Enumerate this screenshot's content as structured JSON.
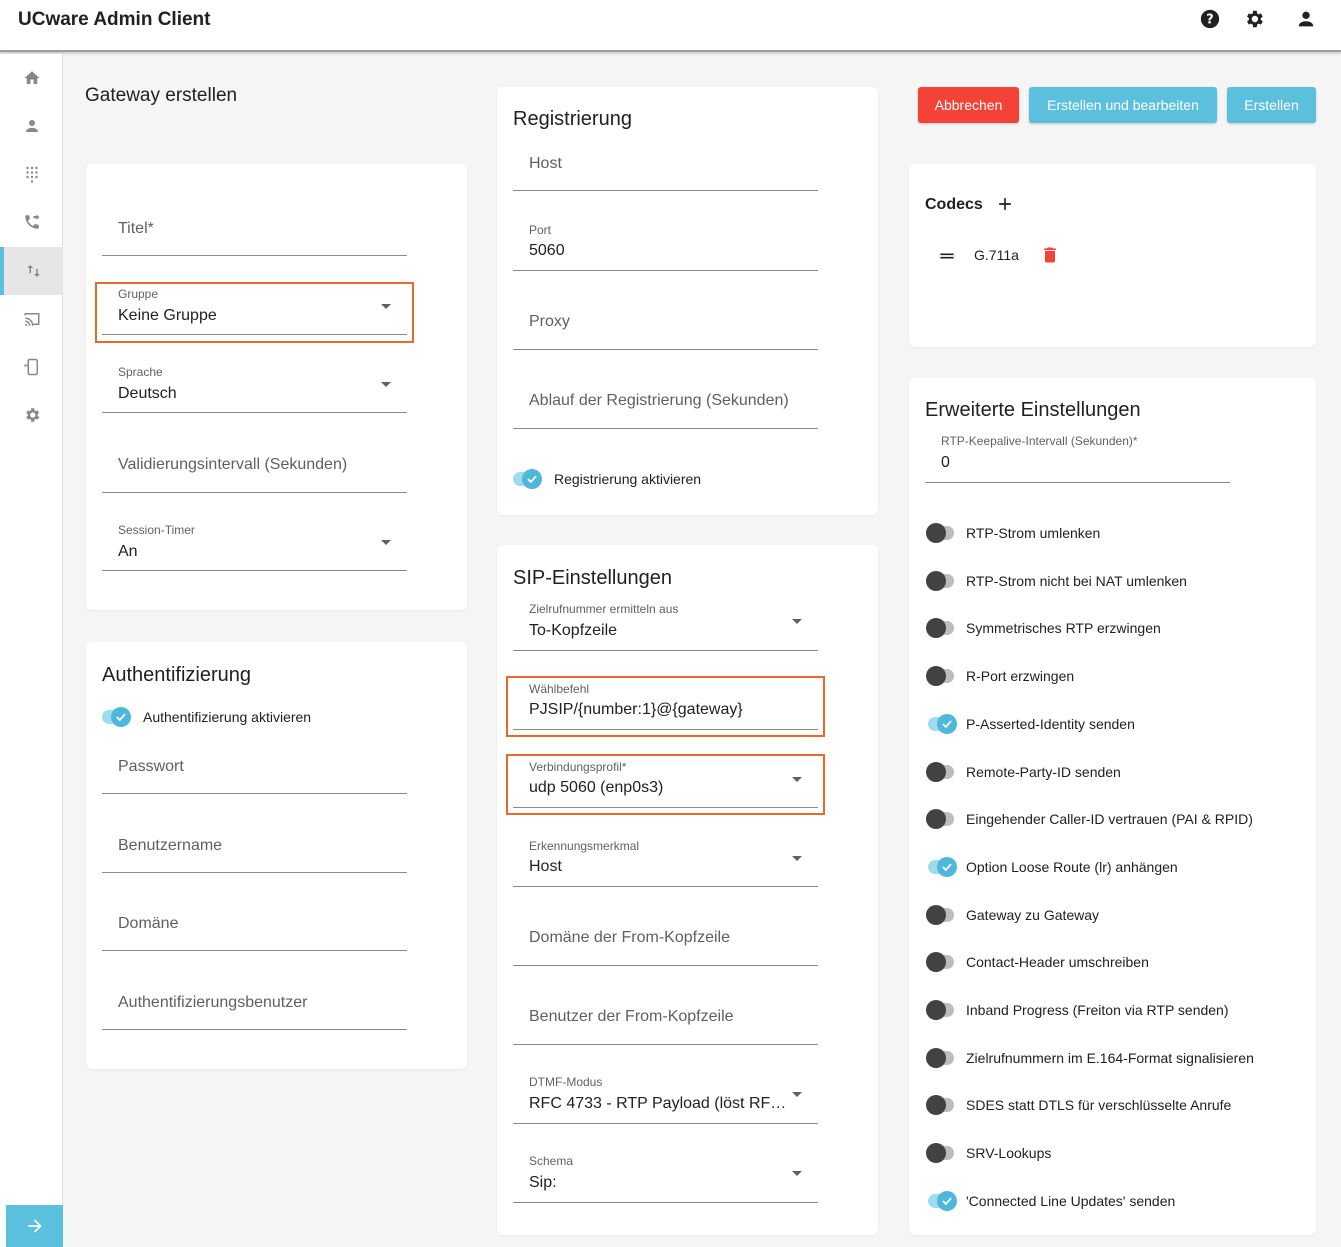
{
  "app": {
    "title": "UCware Admin Client"
  },
  "page": {
    "title": "Gateway erstellen"
  },
  "actions": {
    "cancel": "Abbrechen",
    "create_edit": "Erstellen und bearbeiten",
    "create": "Erstellen"
  },
  "colors": {
    "accent": "#5bc0de",
    "danger": "#f44336",
    "highlight": "#e8692a"
  },
  "general": {
    "title_placeholder": "Titel*",
    "group_label": "Gruppe",
    "group_value": "Keine Gruppe",
    "language_label": "Sprache",
    "language_value": "Deutsch",
    "validation_placeholder": "Validierungsintervall (Sekunden)",
    "session_timer_label": "Session-Timer",
    "session_timer_value": "An"
  },
  "auth": {
    "title": "Authentifizierung",
    "enable_label": "Authentifizierung aktivieren",
    "password": "Passwort",
    "username": "Benutzername",
    "domain": "Domäne",
    "auth_user": "Authentifizierungsbenutzer"
  },
  "registration": {
    "title": "Registrierung",
    "host": "Host",
    "port_label": "Port",
    "port_value": "5060",
    "proxy": "Proxy",
    "expiry": "Ablauf der Registrierung (Sekunden)",
    "enable_label": "Registrierung aktivieren"
  },
  "sip": {
    "title": "SIP-Einstellungen",
    "target_label": "Zielrufnummer ermitteln aus",
    "target_value": "To-Kopfzeile",
    "dial_label": "Wählbefehl",
    "dial_value": "PJSIP/{number:1}@{gateway}",
    "profile_label": "Verbindungsprofil*",
    "profile_value": "udp 5060 (enp0s3)",
    "identify_label": "Erkennungsmerkmal",
    "identify_value": "Host",
    "from_domain": "Domäne der From-Kopfzeile",
    "from_user": "Benutzer der From-Kopfzeile",
    "dtmf_label": "DTMF-Modus",
    "dtmf_value": "RFC 4733 - RTP Payload (löst RF…",
    "schema_label": "Schema",
    "schema_value": "Sip:"
  },
  "codecs": {
    "title": "Codecs",
    "items": [
      "G.711a"
    ]
  },
  "advanced": {
    "title": "Erweiterte Einstellungen",
    "keepalive_label": "RTP-Keepalive-Intervall (Sekunden)*",
    "keepalive_value": "0",
    "toggles": [
      {
        "label": "RTP-Strom umlenken",
        "on": false
      },
      {
        "label": "RTP-Strom nicht bei NAT umlenken",
        "on": false
      },
      {
        "label": "Symmetrisches RTP erzwingen",
        "on": false
      },
      {
        "label": "R-Port erzwingen",
        "on": false
      },
      {
        "label": "P-Asserted-Identity senden",
        "on": true
      },
      {
        "label": "Remote-Party-ID senden",
        "on": false
      },
      {
        "label": "Eingehender Caller-ID vertrauen (PAI & RPID)",
        "on": false
      },
      {
        "label": "Option Loose Route (lr) anhängen",
        "on": true
      },
      {
        "label": "Gateway zu Gateway",
        "on": false
      },
      {
        "label": "Contact-Header umschreiben",
        "on": false
      },
      {
        "label": "Inband Progress (Freiton via RTP senden)",
        "on": false
      },
      {
        "label": "Zielrufnummern im E.164-Format signalisieren",
        "on": false
      },
      {
        "label": "SDES statt DTLS für verschlüsselte Anrufe",
        "on": false
      },
      {
        "label": "SRV-Lookups",
        "on": false
      },
      {
        "label": "'Connected Line Updates' senden",
        "on": true
      }
    ]
  },
  "nav": {
    "items": [
      "home-icon",
      "user-icon",
      "dialpad-icon",
      "call-forward-icon",
      "gateway-icon",
      "cast-icon",
      "phone-device-icon",
      "settings-icon"
    ],
    "active": "gateway-icon"
  }
}
